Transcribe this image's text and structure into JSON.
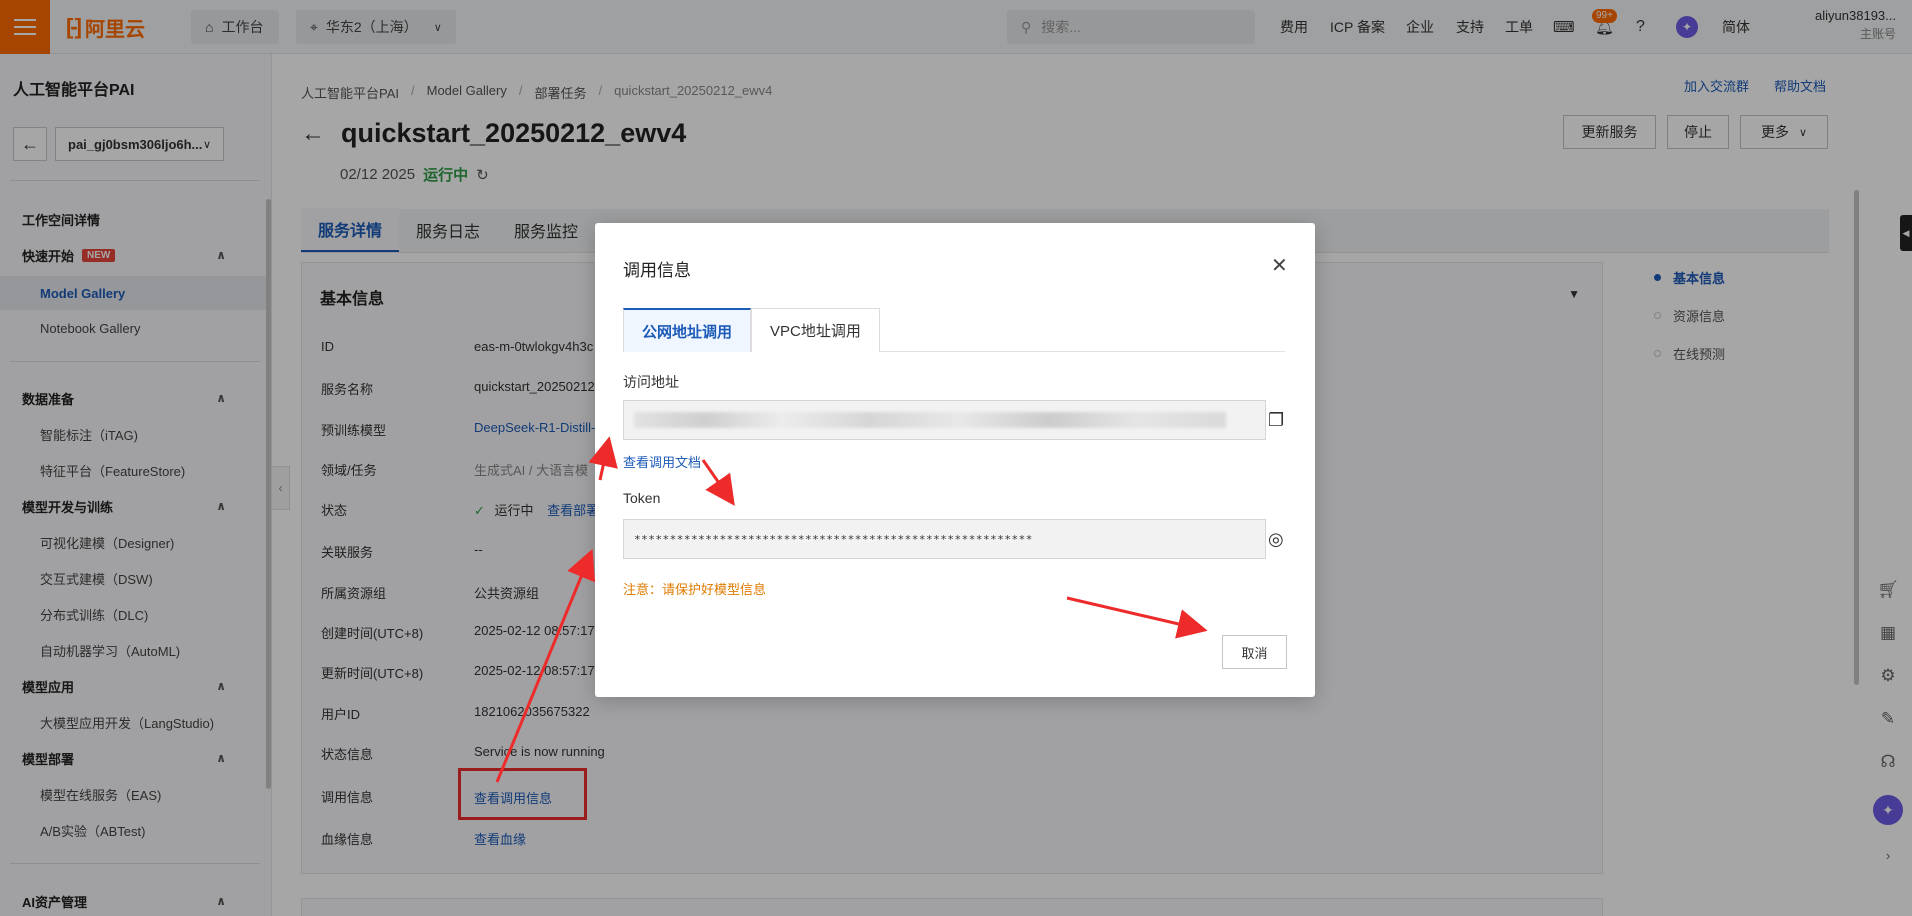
{
  "topbar": {
    "logo_text": "阿里云",
    "workbench_label": "工作台",
    "region_label": "华东2（上海）",
    "search_placeholder": "搜索...",
    "nav": [
      "费用",
      "ICP 备案",
      "企业",
      "支持",
      "工单"
    ],
    "notification_badge": "99+",
    "lang_label": "简体",
    "username": "aliyun38193...",
    "account_type": "主账号"
  },
  "sidebar": {
    "title": "人工智能平台PAI",
    "workspace": "pai_gj0bsm306ljo6h...",
    "workspace_detail": "工作空间详情",
    "quick_start": "快速开始",
    "new_tag": "NEW",
    "model_gallery": "Model Gallery",
    "notebook_gallery": "Notebook Gallery",
    "data_prep": "数据准备",
    "itag": "智能标注（iTAG)",
    "feature_store": "特征平台（FeatureStore)",
    "dev_train": "模型开发与训练",
    "designer": "可视化建模（Designer)",
    "dsw": "交互式建模（DSW)",
    "dlc": "分布式训练（DLC)",
    "automl": "自动机器学习（AutoML)",
    "model_app": "模型应用",
    "langstudio": "大模型应用开发（LangStudio)",
    "model_deploy": "模型部署",
    "eas": "模型在线服务（EAS)",
    "abtest": "A/B实验（ABTest)",
    "ai_asset": "AI资产管理"
  },
  "breadcrumb": [
    "人工智能平台PAI",
    "Model Gallery",
    "部署任务",
    "quickstart_20250212_ewv4"
  ],
  "top_links": {
    "join_group": "加入交流群",
    "help_docs": "帮助文档"
  },
  "page": {
    "title": "quickstart_20250212_ewv4",
    "date": "02/12 2025",
    "status": "运行中",
    "update_btn": "更新服务",
    "stop_btn": "停止",
    "more_btn": "更多"
  },
  "tabs": [
    "服务详情",
    "服务日志",
    "服务监控"
  ],
  "card": {
    "title": "基本信息",
    "rows": [
      {
        "k": "ID",
        "v": "eas-m-0twlokgv4h3c"
      },
      {
        "k": "服务名称",
        "v": "quickstart_20250212"
      },
      {
        "k": "预训练模型",
        "v": "DeepSeek-R1-Distill-"
      },
      {
        "k": "领域/任务",
        "v": "生成式AI / 大语言模"
      },
      {
        "k": "状态",
        "v": "运行中",
        "v2": "查看部署"
      },
      {
        "k": "关联服务",
        "v": "--"
      },
      {
        "k": "所属资源组",
        "v": "公共资源组"
      },
      {
        "k": "创建时间(UTC+8)",
        "v": "2025-02-12 08:57:17"
      },
      {
        "k": "更新时间(UTC+8)",
        "v": "2025-02-12 08:57:17"
      },
      {
        "k": "用户ID",
        "v": "1821062035675322"
      },
      {
        "k": "状态信息",
        "v": "Service is now running"
      },
      {
        "k": "调用信息",
        "v": "查看调用信息"
      },
      {
        "k": "血缘信息",
        "v": "查看血缘"
      }
    ]
  },
  "anchor_nav": [
    "基本信息",
    "资源信息",
    "在线预测"
  ],
  "modal": {
    "title": "调用信息",
    "tab_public": "公网地址调用",
    "tab_vpc": "VPC地址调用",
    "endpoint_label": "访问地址",
    "doc_link": "查看调用文档",
    "token_label": "Token",
    "token_value": "********************************************************",
    "warning": "注意：请保护好模型信息",
    "cancel_btn": "取消"
  },
  "colors": {
    "brand": "#ff6a00",
    "link": "#1d5bb8",
    "success": "#2e9d48",
    "annotation": "#ee2b2b"
  }
}
